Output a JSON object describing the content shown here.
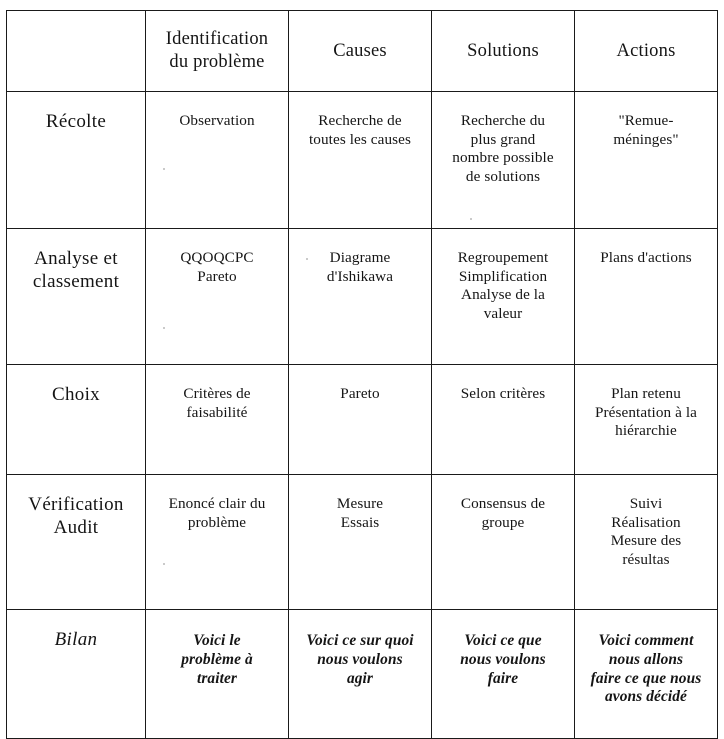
{
  "table": {
    "corner_label": "",
    "columns": [
      "Identification\ndu problème",
      "Causes",
      "Solutions",
      "Actions"
    ],
    "rows": [
      {
        "label": "Récolte",
        "label_style": "bold",
        "cells": [
          "Observation",
          "Recherche de\ntoutes les causes",
          "Recherche du\nplus grand\nnombre possible\nde solutions",
          "\"Remue-\nméninges\""
        ]
      },
      {
        "label": "Analyse et\nclassement",
        "label_style": "bold",
        "cells": [
          "QQOQCPC\nPareto",
          "Diagrame\nd'Ishikawa",
          "Regroupement\nSimplification\nAnalyse de la\nvaleur",
          "Plans d'actions"
        ]
      },
      {
        "label": "Choix",
        "label_style": "bold",
        "cells": [
          "Critères de\nfaisabilité",
          "Pareto",
          "Selon critères",
          "Plan retenu\nPrésentation à la\nhiérarchie"
        ]
      },
      {
        "label": "Vérification\nAudit",
        "label_style": "bold",
        "cells": [
          "Enoncé clair du\nproblème",
          "Mesure\nEssais",
          "Consensus de\ngroupe",
          "Suivi\nRéalisation\nMesure des\nrésultas"
        ]
      },
      {
        "label": "Bilan",
        "label_style": "italic",
        "cells": [
          "Voici le\nproblème à\ntraiter",
          "Voici ce sur quoi\nnous voulons\nagir",
          "Voici ce que\nnous voulons\nfaire",
          "Voici comment\nnous allons\nfaire ce que nous\navons décidé"
        ]
      }
    ]
  },
  "colors": {
    "page_background": "#ffffff",
    "border": "#1a1a1a",
    "text": "#151515"
  }
}
